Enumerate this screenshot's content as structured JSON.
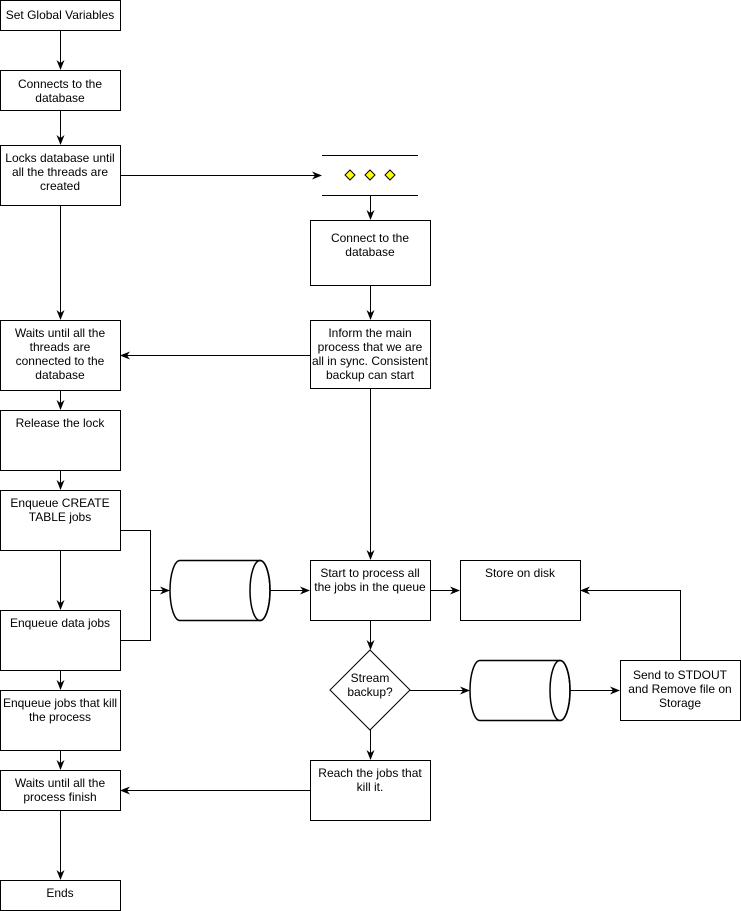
{
  "nodes": {
    "set_globals": [
      "Set Global Variables"
    ],
    "connects_db": [
      "Connects to the",
      "database"
    ],
    "locks_db": [
      "Locks database until",
      "all the threads are",
      "created"
    ],
    "waits_connected": [
      "Waits until all the",
      "threads are",
      "connected to the",
      "database"
    ],
    "release_lock": [
      "Release the lock"
    ],
    "enqueue_create": [
      "Enqueue CREATE",
      "TABLE jobs"
    ],
    "enqueue_data": [
      "Enqueue data jobs"
    ],
    "enqueue_kill": [
      "Enqueue jobs that kill",
      "the process"
    ],
    "waits_finish": [
      "Waits until all the",
      "process finish"
    ],
    "ends": [
      "Ends"
    ],
    "connect_db_thread": [
      "Connect to the",
      "database"
    ],
    "inform_main": [
      "Inform the main",
      "process that we are",
      "all in sync. Consistent",
      "backup can start"
    ],
    "start_process": [
      "Start to process all",
      "the jobs in the queue"
    ],
    "store_disk": [
      "Store on disk"
    ],
    "stream_backup": [
      "Stream",
      "backup?"
    ],
    "reach_kill": [
      "Reach the jobs that",
      "kill it."
    ],
    "send_stdout": [
      "Send to STDOUT",
      "and Remove file on",
      "Storage"
    ]
  },
  "colors": {
    "ellipsis_diamond": "#ffff00"
  }
}
